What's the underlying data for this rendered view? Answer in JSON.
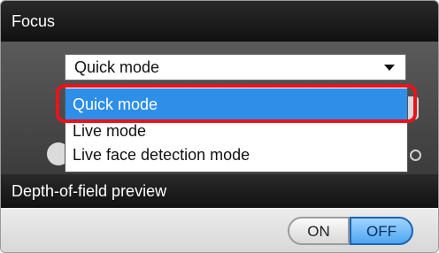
{
  "focus": {
    "title": "Focus",
    "selected": "Quick mode",
    "options": [
      "Quick mode",
      "Live mode",
      "Live face detection mode"
    ],
    "highlighted_option": "Quick mode"
  },
  "dof": {
    "title": "Depth-of-field preview",
    "on_label": "ON",
    "off_label": "OFF",
    "active": "OFF"
  },
  "colors": {
    "selection": "#2f8ee8",
    "callout": "#e8141c",
    "toggle_active": "#4ea6f0"
  },
  "icons": [
    "chevron-down-icon"
  ]
}
